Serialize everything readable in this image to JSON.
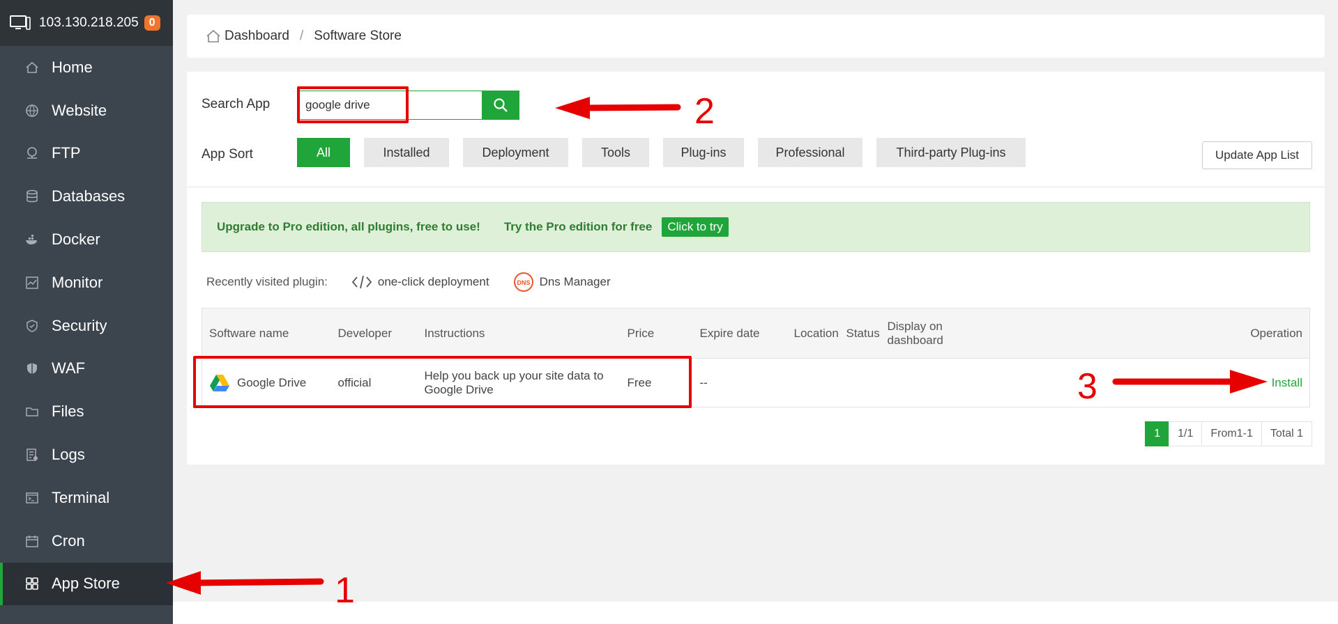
{
  "sidebar": {
    "server_ip": "103.130.218.205",
    "badge": "0",
    "items": [
      {
        "label": "Home",
        "icon": "home-icon"
      },
      {
        "label": "Website",
        "icon": "globe-icon"
      },
      {
        "label": "FTP",
        "icon": "ftp-icon"
      },
      {
        "label": "Databases",
        "icon": "database-icon"
      },
      {
        "label": "Docker",
        "icon": "docker-icon"
      },
      {
        "label": "Monitor",
        "icon": "monitor-icon"
      },
      {
        "label": "Security",
        "icon": "shield-icon"
      },
      {
        "label": "WAF",
        "icon": "waf-shield-icon"
      },
      {
        "label": "Files",
        "icon": "folder-icon"
      },
      {
        "label": "Logs",
        "icon": "log-icon"
      },
      {
        "label": "Terminal",
        "icon": "terminal-icon"
      },
      {
        "label": "Cron",
        "icon": "calendar-icon"
      },
      {
        "label": "App Store",
        "icon": "grid-icon",
        "active": true
      }
    ]
  },
  "breadcrumb": {
    "home": "Dashboard",
    "current": "Software Store"
  },
  "search": {
    "label": "Search App",
    "value": "google drive"
  },
  "sort": {
    "label": "App Sort",
    "options": [
      "All",
      "Installed",
      "Deployment",
      "Tools",
      "Plug-ins",
      "Professional",
      "Third-party Plug-ins"
    ],
    "selected": "All"
  },
  "update_button": "Update App List",
  "promo": {
    "headline": "Upgrade to Pro edition, all plugins, free to use!",
    "try_text": "Try the Pro edition for free",
    "button": "Click to try"
  },
  "recent": {
    "label": "Recently visited plugin:",
    "items": [
      "one-click deployment",
      "Dns Manager"
    ]
  },
  "table": {
    "headers": [
      "Software name",
      "Developer",
      "Instructions",
      "Price",
      "Expire date",
      "Location",
      "Status",
      "Display on dashboard",
      "Operation"
    ],
    "rows": [
      {
        "name": "Google Drive",
        "developer": "official",
        "instructions": "Help you back up your site data to Google Drive",
        "price": "Free",
        "expire": "--",
        "location": "",
        "status": "",
        "display": "",
        "operation": "Install"
      }
    ]
  },
  "pager": {
    "current": "1",
    "pages": "1/1",
    "range": "From1-1",
    "total": "Total 1"
  },
  "annotations": {
    "n1": "1",
    "n2": "2",
    "n3": "3"
  },
  "colors": {
    "accent": "#20a53a",
    "sidebar": "#3c444d",
    "annotation": "#e60000"
  }
}
